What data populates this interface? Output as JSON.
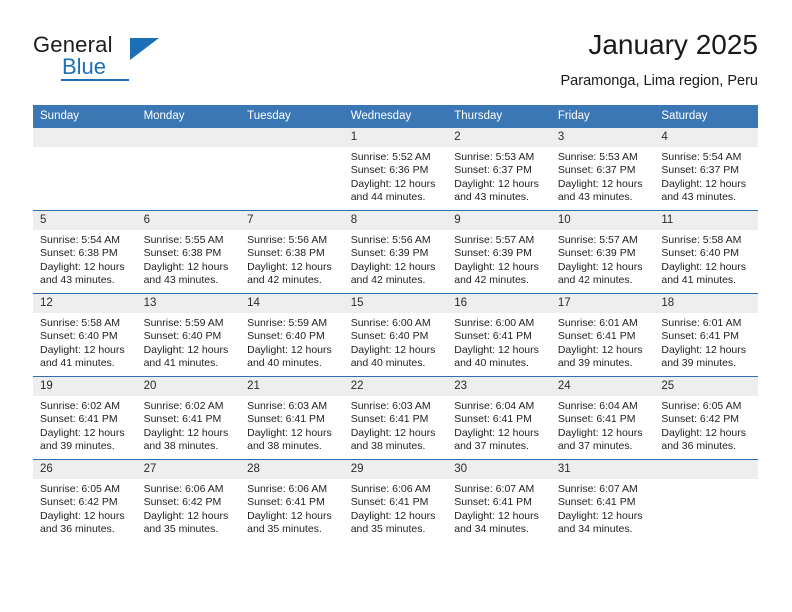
{
  "brand": {
    "name_line1": "General",
    "name_line2": "Blue",
    "logo_icon": "triangle-logo-icon",
    "accent_color": "#1c6fb5"
  },
  "header": {
    "title": "January 2025",
    "subtitle": "Paramonga, Lima region, Peru"
  },
  "calendar": {
    "header_bg": "#3b77b5",
    "row_divider_color": "#2f6fae",
    "daynum_band_bg": "#eeeeee",
    "weekday_headers": [
      "Sunday",
      "Monday",
      "Tuesday",
      "Wednesday",
      "Thursday",
      "Friday",
      "Saturday"
    ],
    "weeks": [
      [
        {
          "day": "",
          "lines": []
        },
        {
          "day": "",
          "lines": []
        },
        {
          "day": "",
          "lines": []
        },
        {
          "day": "1",
          "lines": [
            "Sunrise: 5:52 AM",
            "Sunset: 6:36 PM",
            "Daylight: 12 hours",
            "and 44 minutes."
          ]
        },
        {
          "day": "2",
          "lines": [
            "Sunrise: 5:53 AM",
            "Sunset: 6:37 PM",
            "Daylight: 12 hours",
            "and 43 minutes."
          ]
        },
        {
          "day": "3",
          "lines": [
            "Sunrise: 5:53 AM",
            "Sunset: 6:37 PM",
            "Daylight: 12 hours",
            "and 43 minutes."
          ]
        },
        {
          "day": "4",
          "lines": [
            "Sunrise: 5:54 AM",
            "Sunset: 6:37 PM",
            "Daylight: 12 hours",
            "and 43 minutes."
          ]
        }
      ],
      [
        {
          "day": "5",
          "lines": [
            "Sunrise: 5:54 AM",
            "Sunset: 6:38 PM",
            "Daylight: 12 hours",
            "and 43 minutes."
          ]
        },
        {
          "day": "6",
          "lines": [
            "Sunrise: 5:55 AM",
            "Sunset: 6:38 PM",
            "Daylight: 12 hours",
            "and 43 minutes."
          ]
        },
        {
          "day": "7",
          "lines": [
            "Sunrise: 5:56 AM",
            "Sunset: 6:38 PM",
            "Daylight: 12 hours",
            "and 42 minutes."
          ]
        },
        {
          "day": "8",
          "lines": [
            "Sunrise: 5:56 AM",
            "Sunset: 6:39 PM",
            "Daylight: 12 hours",
            "and 42 minutes."
          ]
        },
        {
          "day": "9",
          "lines": [
            "Sunrise: 5:57 AM",
            "Sunset: 6:39 PM",
            "Daylight: 12 hours",
            "and 42 minutes."
          ]
        },
        {
          "day": "10",
          "lines": [
            "Sunrise: 5:57 AM",
            "Sunset: 6:39 PM",
            "Daylight: 12 hours",
            "and 42 minutes."
          ]
        },
        {
          "day": "11",
          "lines": [
            "Sunrise: 5:58 AM",
            "Sunset: 6:40 PM",
            "Daylight: 12 hours",
            "and 41 minutes."
          ]
        }
      ],
      [
        {
          "day": "12",
          "lines": [
            "Sunrise: 5:58 AM",
            "Sunset: 6:40 PM",
            "Daylight: 12 hours",
            "and 41 minutes."
          ]
        },
        {
          "day": "13",
          "lines": [
            "Sunrise: 5:59 AM",
            "Sunset: 6:40 PM",
            "Daylight: 12 hours",
            "and 41 minutes."
          ]
        },
        {
          "day": "14",
          "lines": [
            "Sunrise: 5:59 AM",
            "Sunset: 6:40 PM",
            "Daylight: 12 hours",
            "and 40 minutes."
          ]
        },
        {
          "day": "15",
          "lines": [
            "Sunrise: 6:00 AM",
            "Sunset: 6:40 PM",
            "Daylight: 12 hours",
            "and 40 minutes."
          ]
        },
        {
          "day": "16",
          "lines": [
            "Sunrise: 6:00 AM",
            "Sunset: 6:41 PM",
            "Daylight: 12 hours",
            "and 40 minutes."
          ]
        },
        {
          "day": "17",
          "lines": [
            "Sunrise: 6:01 AM",
            "Sunset: 6:41 PM",
            "Daylight: 12 hours",
            "and 39 minutes."
          ]
        },
        {
          "day": "18",
          "lines": [
            "Sunrise: 6:01 AM",
            "Sunset: 6:41 PM",
            "Daylight: 12 hours",
            "and 39 minutes."
          ]
        }
      ],
      [
        {
          "day": "19",
          "lines": [
            "Sunrise: 6:02 AM",
            "Sunset: 6:41 PM",
            "Daylight: 12 hours",
            "and 39 minutes."
          ]
        },
        {
          "day": "20",
          "lines": [
            "Sunrise: 6:02 AM",
            "Sunset: 6:41 PM",
            "Daylight: 12 hours",
            "and 38 minutes."
          ]
        },
        {
          "day": "21",
          "lines": [
            "Sunrise: 6:03 AM",
            "Sunset: 6:41 PM",
            "Daylight: 12 hours",
            "and 38 minutes."
          ]
        },
        {
          "day": "22",
          "lines": [
            "Sunrise: 6:03 AM",
            "Sunset: 6:41 PM",
            "Daylight: 12 hours",
            "and 38 minutes."
          ]
        },
        {
          "day": "23",
          "lines": [
            "Sunrise: 6:04 AM",
            "Sunset: 6:41 PM",
            "Daylight: 12 hours",
            "and 37 minutes."
          ]
        },
        {
          "day": "24",
          "lines": [
            "Sunrise: 6:04 AM",
            "Sunset: 6:41 PM",
            "Daylight: 12 hours",
            "and 37 minutes."
          ]
        },
        {
          "day": "25",
          "lines": [
            "Sunrise: 6:05 AM",
            "Sunset: 6:42 PM",
            "Daylight: 12 hours",
            "and 36 minutes."
          ]
        }
      ],
      [
        {
          "day": "26",
          "lines": [
            "Sunrise: 6:05 AM",
            "Sunset: 6:42 PM",
            "Daylight: 12 hours",
            "and 36 minutes."
          ]
        },
        {
          "day": "27",
          "lines": [
            "Sunrise: 6:06 AM",
            "Sunset: 6:42 PM",
            "Daylight: 12 hours",
            "and 35 minutes."
          ]
        },
        {
          "day": "28",
          "lines": [
            "Sunrise: 6:06 AM",
            "Sunset: 6:41 PM",
            "Daylight: 12 hours",
            "and 35 minutes."
          ]
        },
        {
          "day": "29",
          "lines": [
            "Sunrise: 6:06 AM",
            "Sunset: 6:41 PM",
            "Daylight: 12 hours",
            "and 35 minutes."
          ]
        },
        {
          "day": "30",
          "lines": [
            "Sunrise: 6:07 AM",
            "Sunset: 6:41 PM",
            "Daylight: 12 hours",
            "and 34 minutes."
          ]
        },
        {
          "day": "31",
          "lines": [
            "Sunrise: 6:07 AM",
            "Sunset: 6:41 PM",
            "Daylight: 12 hours",
            "and 34 minutes."
          ]
        },
        {
          "day": "",
          "lines": []
        }
      ]
    ]
  }
}
